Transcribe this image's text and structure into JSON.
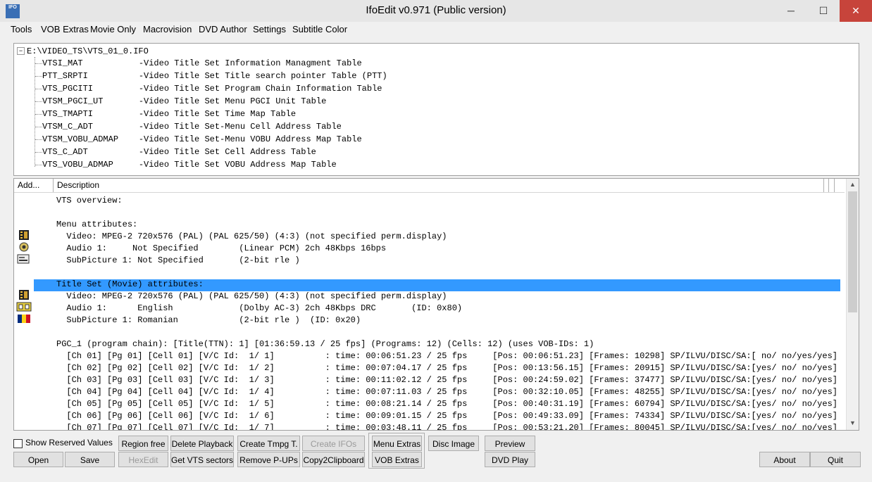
{
  "window": {
    "title": "IfoEdit v0.971 (Public version)",
    "icon_text": "IFO",
    "min": "─",
    "max": "☐",
    "close": "✕"
  },
  "menu": [
    "Tools",
    "VOB Extras",
    "Movie Only",
    "Macrovision",
    "DVD Author",
    "Settings",
    "Subtitle Color"
  ],
  "tree": {
    "root": "E:\\VIDEO_TS\\VTS_01_0.IFO",
    "expander": "−",
    "items": [
      "VTSI_MAT           -Video Title Set Information Managment Table",
      "PTT_SRPTI          -Video Title Set Title search pointer Table (PTT)",
      "VTS_PGCITI         -Video Title Set Program Chain Information Table",
      "VTSM_PGCI_UT       -Video Title Set Menu PGCI Unit Table",
      "VTS_TMAPTI         -Video Title Set Time Map Table",
      "VTSM_C_ADT         -Video Title Set-Menu Cell Address Table",
      "VTSM_VOBU_ADMAP    -Video Title Set-Menu VOBU Address Map Table",
      "VTS_C_ADT          -Video Title Set Cell Address Table",
      "VTS_VOBU_ADMAP     -Video Title Set VOBU Address Map Table"
    ]
  },
  "list": {
    "col_add": "Add...",
    "col_desc": "Description",
    "rows": [
      "VTS overview:",
      "",
      "Menu attributes:",
      "  Video: MPEG-2 720x576 (PAL) (PAL 625/50) (4:3) (not specified perm.display)",
      "  Audio 1:     Not Specified        (Linear PCM) 2ch 48Kbps 16bps",
      "  SubPicture 1: Not Specified       (2-bit rle )",
      "",
      "Title Set (Movie) attributes:",
      "  Video: MPEG-2 720x576 (PAL) (PAL 625/50) (4:3) (not specified perm.display)",
      "  Audio 1:      English             (Dolby AC-3) 2ch 48Kbps DRC       (ID: 0x80)",
      "  SubPicture 1: Romanian            (2-bit rle )  (ID: 0x20)",
      "",
      "PGC_1 (program chain): [Title(TTN): 1] [01:36:59.13 / 25 fps] (Programs: 12) (Cells: 12) (uses VOB-IDs: 1)",
      "  [Ch 01] [Pg 01] [Cell 01] [V/C Id:  1/ 1]          : time: 00:06:51.23 / 25 fps     [Pos: 00:06:51.23] [Frames: 10298] SP/ILVU/DISC/SA:[ no/ no/yes/yes]",
      "  [Ch 02] [Pg 02] [Cell 02] [V/C Id:  1/ 2]          : time: 00:07:04.17 / 25 fps     [Pos: 00:13:56.15] [Frames: 20915] SP/ILVU/DISC/SA:[yes/ no/ no/yes]",
      "  [Ch 03] [Pg 03] [Cell 03] [V/C Id:  1/ 3]          : time: 00:11:02.12 / 25 fps     [Pos: 00:24:59.02] [Frames: 37477] SP/ILVU/DISC/SA:[yes/ no/ no/yes]",
      "  [Ch 04] [Pg 04] [Cell 04] [V/C Id:  1/ 4]          : time: 00:07:11.03 / 25 fps     [Pos: 00:32:10.05] [Frames: 48255] SP/ILVU/DISC/SA:[yes/ no/ no/yes]",
      "  [Ch 05] [Pg 05] [Cell 05] [V/C Id:  1/ 5]          : time: 00:08:21.14 / 25 fps     [Pos: 00:40:31.19] [Frames: 60794] SP/ILVU/DISC/SA:[yes/ no/ no/yes]",
      "  [Ch 06] [Pg 06] [Cell 06] [V/C Id:  1/ 6]          : time: 00:09:01.15 / 25 fps     [Pos: 00:49:33.09] [Frames: 74334] SP/ILVU/DISC/SA:[yes/ no/ no/yes]",
      "  [Ch 07] [Pg 07] [Cell 07] [V/C Id:  1/ 7]          : time: 00:03:48.11 / 25 fps     [Pos: 00:53:21.20] [Frames: 80045] SP/ILVU/DISC/SA:[yes/ no/ no/yes]"
    ],
    "scroll_up": "▲",
    "scroll_down": "▼"
  },
  "controls": {
    "show_reserved": "Show Reserved Values",
    "open": "Open",
    "save": "Save",
    "region_free": "Region free",
    "hexedit": "HexEdit",
    "delete_playback": "Delete Playback",
    "get_vts_sectors": "Get VTS sectors",
    "create_tmpg": "Create Tmpg T.",
    "remove_pups": "Remove P-UPs",
    "create_ifos": "Create IFOs",
    "copy2clipboard": "Copy2Clipboard",
    "menu_extras": "Menu Extras",
    "vob_extras": "VOB Extras",
    "disc_image": "Disc Image",
    "preview": "Preview",
    "dvd_play": "DVD Play",
    "about": "About",
    "quit": "Quit"
  },
  "colors": {
    "selection": "#3399ff",
    "close_button": "#c7443b"
  }
}
